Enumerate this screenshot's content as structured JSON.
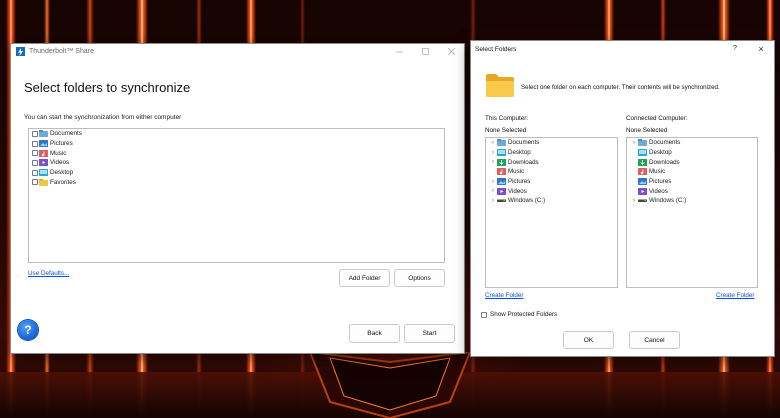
{
  "share_window": {
    "title": "Thunderbolt™ Share",
    "heading": "Select folders to synchronize",
    "subtitle": "You can start the synchronization from either computer",
    "folders": [
      {
        "label": "Documents",
        "icon": "documents-folder-icon",
        "checked": false
      },
      {
        "label": "Pictures",
        "icon": "pictures-folder-icon",
        "checked": false
      },
      {
        "label": "Music",
        "icon": "music-folder-icon",
        "checked": false
      },
      {
        "label": "Videos",
        "icon": "videos-folder-icon",
        "checked": false
      },
      {
        "label": "Desktop",
        "icon": "desktop-folder-icon",
        "checked": false
      },
      {
        "label": "Favorites",
        "icon": "favorites-folder-icon",
        "checked": false
      }
    ],
    "use_defaults_link": "Use Defaults...",
    "add_folder_button": "Add Folder",
    "options_button": "Options",
    "back_button": "Back",
    "start_button": "Start",
    "help_glyph": "?"
  },
  "folders_dialog": {
    "title": "Select Folders",
    "help_glyph": "?",
    "close_glyph": "×",
    "instruction": "Select one folder on each computer.  Their contents will be synchronized.",
    "this_computer": {
      "label": "This Computer:",
      "selection": "None Selected",
      "items": [
        {
          "label": "Documents",
          "expandable": true,
          "icon": "documents-folder-icon"
        },
        {
          "label": "Desktop",
          "expandable": true,
          "icon": "desktop-folder-icon"
        },
        {
          "label": "Downloads",
          "expandable": true,
          "icon": "downloads-folder-icon"
        },
        {
          "label": "Music",
          "expandable": false,
          "icon": "music-folder-icon"
        },
        {
          "label": "Pictures",
          "expandable": true,
          "icon": "pictures-folder-icon"
        },
        {
          "label": "Videos",
          "expandable": true,
          "icon": "videos-folder-icon"
        },
        {
          "label": "Windows (C:)",
          "expandable": true,
          "icon": "drive-icon"
        }
      ],
      "create_folder_link": "Create Folder"
    },
    "connected_computer": {
      "label": "Connected Computer:",
      "selection": "None Selected",
      "items": [
        {
          "label": "Documents",
          "expandable": true,
          "icon": "documents-folder-icon"
        },
        {
          "label": "Desktop",
          "expandable": false,
          "icon": "desktop-folder-icon"
        },
        {
          "label": "Downloads",
          "expandable": false,
          "icon": "downloads-folder-icon"
        },
        {
          "label": "Music",
          "expandable": false,
          "icon": "music-folder-icon"
        },
        {
          "label": "Pictures",
          "expandable": false,
          "icon": "pictures-folder-icon"
        },
        {
          "label": "Videos",
          "expandable": false,
          "icon": "videos-folder-icon"
        },
        {
          "label": "Windows (C:)",
          "expandable": true,
          "icon": "drive-icon"
        }
      ],
      "create_folder_link": "Create Folder"
    },
    "show_protected_label": "Show Protected Folders",
    "show_protected_checked": false,
    "ok_button": "OK",
    "cancel_button": "Cancel"
  },
  "colors": {
    "accent_blue": "#1769c9",
    "link": "#0b4fd3",
    "folder_yellow": "#f6c444",
    "wallpaper_glow": "#ff5412"
  }
}
